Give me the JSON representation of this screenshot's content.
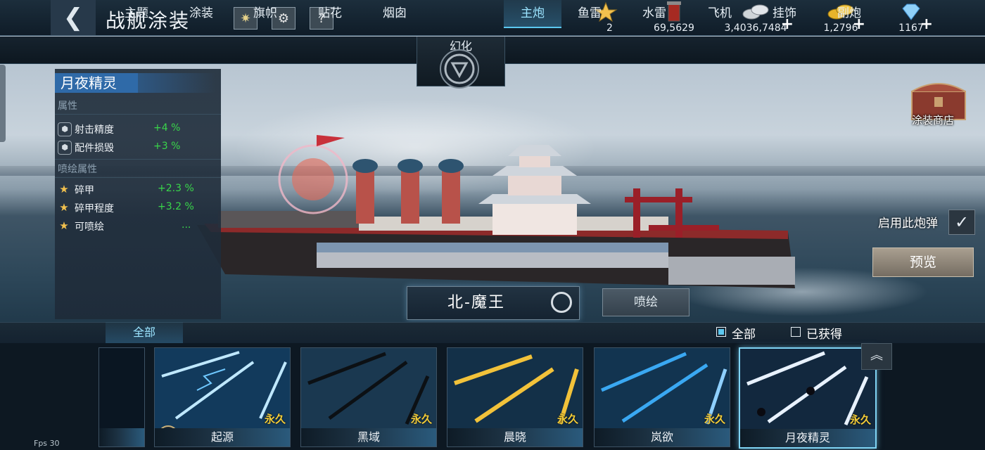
{
  "header": {
    "title": "战舰涂装",
    "help_label": "?",
    "resources": [
      {
        "icon": "star-icon",
        "value": "2",
        "has_plus": false
      },
      {
        "icon": "paint-bucket-icon",
        "value": "69,5629",
        "has_plus": false
      },
      {
        "icon": "silver-coins-icon",
        "value": "3,4036,7484",
        "has_plus": true
      },
      {
        "icon": "gold-coins-icon",
        "value": "1,2796",
        "has_plus": true
      },
      {
        "icon": "diamond-icon",
        "value": "1167",
        "has_plus": true
      }
    ],
    "plus_symbol": "+"
  },
  "tabs": {
    "left": [
      "主题",
      "涂装",
      "旗帜",
      "贴花",
      "烟囱"
    ],
    "center": "幻化",
    "right": [
      "主炮",
      "鱼雷",
      "水雷",
      "飞机",
      "挂饰",
      "副炮"
    ],
    "active": "主炮"
  },
  "panel": {
    "skin_name": "月夜精灵",
    "attributes_heading": "属性",
    "attributes": [
      {
        "name": "射击精度",
        "value": "+4 %"
      },
      {
        "name": "配件损毁",
        "value": "+3 %"
      }
    ],
    "spray_heading": "喷绘属性",
    "spray_attributes": [
      {
        "name": "碎甲",
        "value": "+2.3 %"
      },
      {
        "name": "碎甲程度",
        "value": "+3.2 %"
      },
      {
        "name": "可喷绘",
        "value": "..."
      }
    ]
  },
  "right": {
    "shop_label": "涂装商店",
    "use_shell_label": "启用此炮弹",
    "preview_label": "预览"
  },
  "ship": {
    "name": "北-魔王",
    "spray_label": "喷绘"
  },
  "filter": {
    "all_tab": "全部",
    "all_check_label": "全部",
    "all_checked": true,
    "owned_label": "已获得",
    "owned_checked": false
  },
  "cards": [
    {
      "name": "",
      "tag": "",
      "color": "#f2dc3a",
      "selected": false
    },
    {
      "name": "起源",
      "tag": "永久",
      "color": "#8fd8ff",
      "selected": false
    },
    {
      "name": "黑域",
      "tag": "永久",
      "color": "#1a2a3a",
      "selected": false
    },
    {
      "name": "晨晓",
      "tag": "永久",
      "color": "#f2c23a",
      "selected": false
    },
    {
      "name": "岚欲",
      "tag": "永久",
      "color": "#3aa8f2",
      "selected": false
    },
    {
      "name": "月夜精灵",
      "tag": "永久",
      "color": "#e8f2ff",
      "selected": true
    }
  ],
  "fps_label": "Fps 30",
  "colors": {
    "accent": "#5cc8f0",
    "positive": "#39d64a",
    "badge": "#f2cc3a"
  }
}
